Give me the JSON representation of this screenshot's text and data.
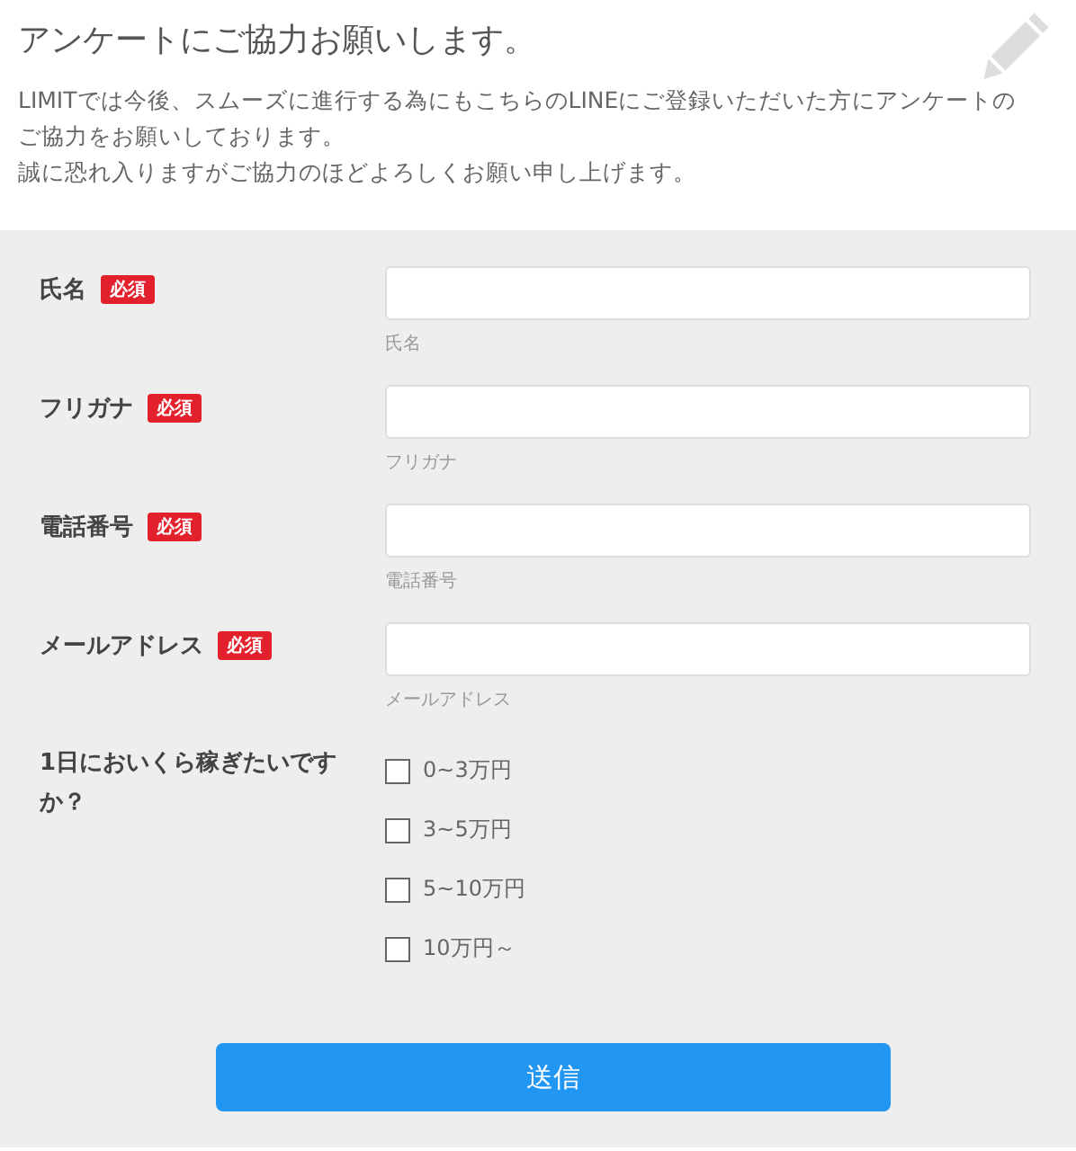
{
  "header": {
    "title": "アンケートにご協力お願いします。",
    "lines": [
      "LIMITでは今後、スムーズに進行する為にもこちらのLINEにご登録いただいた方にアンケートのご協力をお願いしております。",
      "誠に恐れ入りますがご協力のほどよろしくお願い申し上げます。"
    ]
  },
  "fields": [
    {
      "label": "氏名",
      "badge": "必須",
      "hint": "氏名"
    },
    {
      "label": "フリガナ",
      "badge": "必須",
      "hint": "フリガナ"
    },
    {
      "label": "電話番号",
      "badge": "必須",
      "hint": "電話番号"
    },
    {
      "label": "メールアドレス",
      "badge": "必須",
      "hint": "メールアドレス"
    }
  ],
  "question": {
    "label": "1日においくら稼ぎたいですか？",
    "options": [
      {
        "label": "0~3万円",
        "checked": false
      },
      {
        "label": "3~5万円",
        "checked": false
      },
      {
        "label": "5~10万円",
        "checked": false
      },
      {
        "label": "10万円～",
        "checked": false
      }
    ]
  },
  "submit": "送信"
}
